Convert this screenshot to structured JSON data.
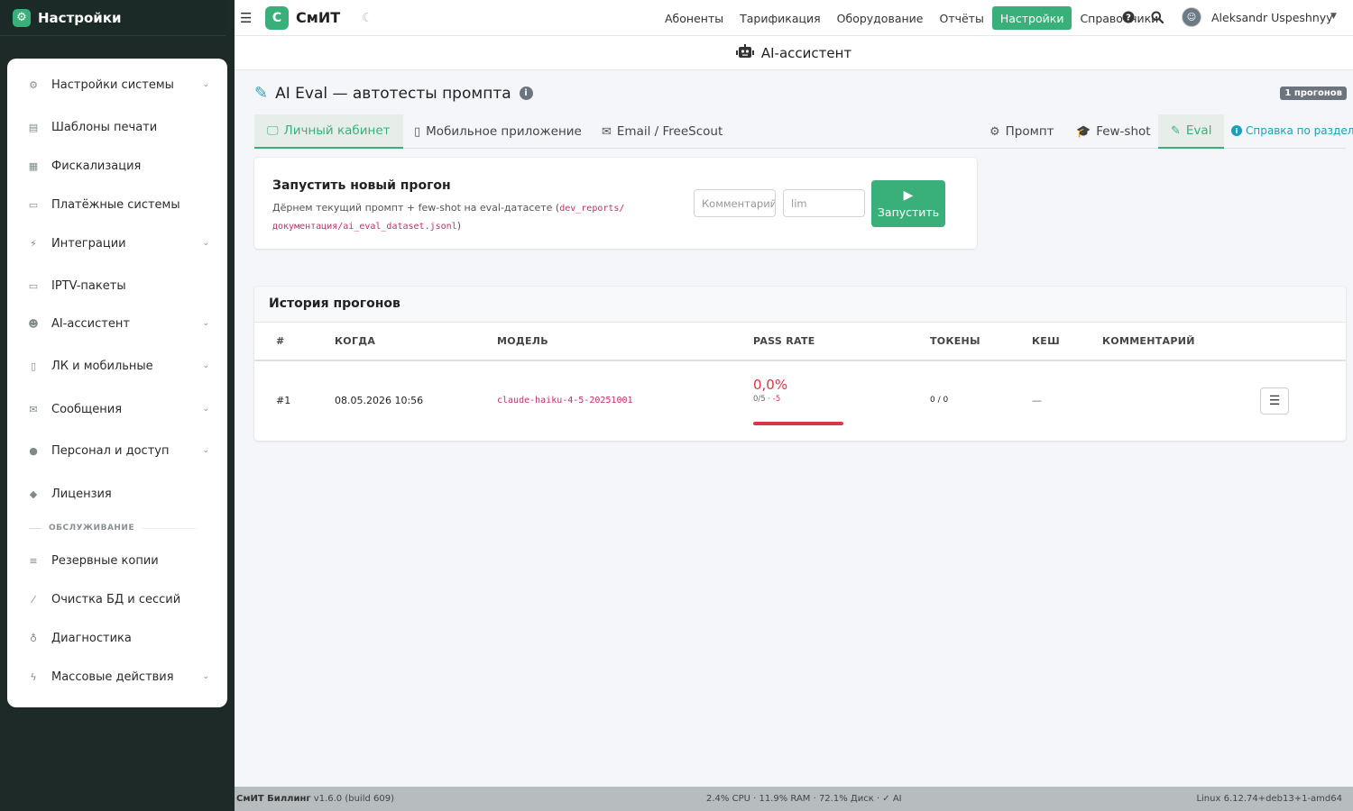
{
  "sidebar": {
    "brand": "Настройки",
    "items": [
      {
        "label": "Настройки системы",
        "icon": "cogs-icon",
        "glyph": "⚙",
        "chevron": true
      },
      {
        "label": "Шаблоны печати",
        "icon": "printer-icon",
        "glyph": "▤",
        "chevron": false
      },
      {
        "label": "Фискализация",
        "icon": "cash-register-icon",
        "glyph": "▦",
        "chevron": false
      },
      {
        "label": "Платёжные системы",
        "icon": "credit-card-icon",
        "glyph": "▭",
        "chevron": false
      },
      {
        "label": "Интеграции",
        "icon": "plug-icon",
        "glyph": "⚡",
        "chevron": true
      },
      {
        "label": "IPTV-пакеты",
        "icon": "tv-icon",
        "glyph": "▭",
        "chevron": false
      },
      {
        "label": "AI-ассистент",
        "icon": "robot-icon",
        "glyph": "☻",
        "chevron": true
      },
      {
        "label": "ЛК и мобильные",
        "icon": "mobile-icon",
        "glyph": "▯",
        "chevron": true
      },
      {
        "label": "Сообщения",
        "icon": "envelope-icon",
        "glyph": "✉",
        "chevron": true
      },
      {
        "label": "Персонал и доступ",
        "icon": "users-icon",
        "glyph": "●",
        "chevron": true
      },
      {
        "label": "Лицензия",
        "icon": "shield-icon",
        "glyph": "◆",
        "chevron": false
      },
      {
        "label": "Резервные копии",
        "icon": "database-icon",
        "glyph": "≡",
        "chevron": false
      },
      {
        "label": "Очистка БД и сессий",
        "icon": "broom-icon",
        "glyph": "⁄",
        "chevron": false
      },
      {
        "label": "Диагностика",
        "icon": "stethoscope-icon",
        "glyph": "♁",
        "chevron": false
      },
      {
        "label": "Массовые действия",
        "icon": "bolt-icon",
        "glyph": "ϟ",
        "chevron": true
      }
    ],
    "section_label": "ОБСЛУЖИВАНИЕ"
  },
  "topbar": {
    "app_logo": "С",
    "app_name": "СмИТ",
    "nav": [
      "Абоненты",
      "Тарификация",
      "Оборудование",
      "Отчёты",
      "Настройки",
      "Справочники"
    ],
    "active_nav": "Настройки",
    "user_name": "Aleksandr Uspeshnyy"
  },
  "section": {
    "title": "AI-ассистент"
  },
  "page": {
    "title": "AI Eval — автотесты промпта",
    "runs_badge": "1 прогонов"
  },
  "tabs_left": [
    {
      "label": "Личный кабинет",
      "icon": "desktop-icon",
      "glyph": "🖵",
      "active": true
    },
    {
      "label": "Мобильное приложение",
      "icon": "mobile-icon",
      "glyph": "▯",
      "active": false
    },
    {
      "label": "Email / FreeScout",
      "icon": "envelope-icon",
      "glyph": "✉",
      "active": false
    }
  ],
  "tabs_right": [
    {
      "label": "Промпт",
      "icon": "gear-icon",
      "glyph": "⚙",
      "active": false
    },
    {
      "label": "Few-shot",
      "icon": "graduation-cap-icon",
      "glyph": "🎓",
      "active": false
    },
    {
      "label": "Eval",
      "icon": "pen-icon",
      "glyph": "✎",
      "active": true
    }
  ],
  "help_link": "Справка по разделу",
  "run": {
    "title": "Запустить новый прогон",
    "desc_prefix": "Дёрнем текущий промпт + few-shot на eval-датасете (",
    "desc_code": "dev_reports/ документация/ai_eval_dataset.jsonl",
    "desc_suffix": ")",
    "comment_placeholder": "Комментарий",
    "lim_placeholder": "lim",
    "button_label": "Запустить"
  },
  "history": {
    "title": "История прогонов",
    "columns": [
      "#",
      "КОГДА",
      "МОДЕЛЬ",
      "PASS RATE",
      "ТОКЕНЫ",
      "КЕШ",
      "КОММЕНТАРИЙ"
    ],
    "rows": [
      {
        "id": "#1",
        "when": "08.05.2026 10:56",
        "model": "claude-haiku-4-5-20251001",
        "pass_rate": "0,0%",
        "pass_detail": "0/5 · ",
        "pass_neg": "-5",
        "pass_fraction": 0.0,
        "tokens": "0 / 0",
        "cache": "—",
        "comment": ""
      }
    ]
  },
  "footer": {
    "product": "СмИТ Биллинг",
    "version": "v1.6.0 (build 609)",
    "stats": "2.4% CPU · 11.9% RAM · 72.1% Диск · ✓ AI",
    "kernel": "Linux 6.12.74+deb13+1-amd64"
  },
  "colors": {
    "accent": "#39b07a",
    "danger": "#dc3545",
    "sidebar_bg": "#1e2a27"
  }
}
